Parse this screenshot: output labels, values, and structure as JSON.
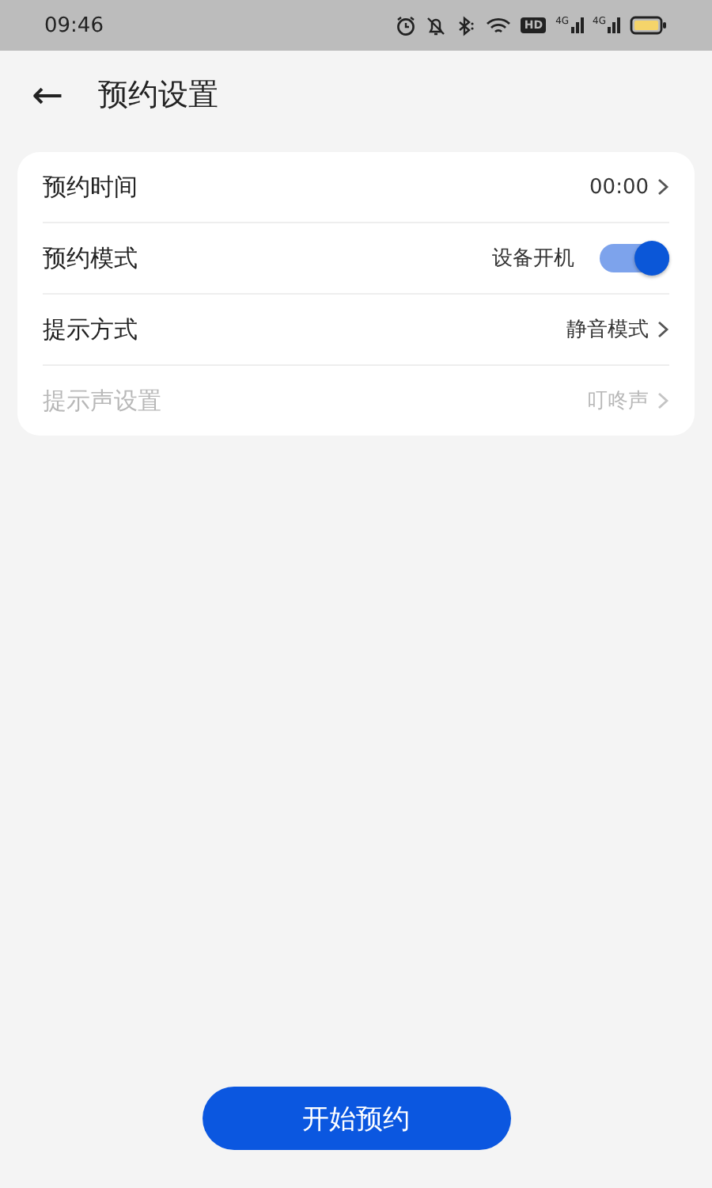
{
  "status_bar": {
    "time": "09:46",
    "hd_badge": "HD",
    "signals": [
      "4G",
      "4G"
    ]
  },
  "header": {
    "back_icon": "←",
    "title": "预约设置"
  },
  "settings": [
    {
      "kind": "value",
      "label": "预约时间",
      "value": "00:00",
      "disabled": false
    },
    {
      "kind": "switch",
      "label": "预约模式",
      "value": "设备开机",
      "on": true,
      "disabled": false
    },
    {
      "kind": "value",
      "label": "提示方式",
      "value": "静音模式",
      "disabled": false
    },
    {
      "kind": "value",
      "label": "提示声设置",
      "value": "叮咚声",
      "disabled": true
    }
  ],
  "start_button": "开始预约"
}
